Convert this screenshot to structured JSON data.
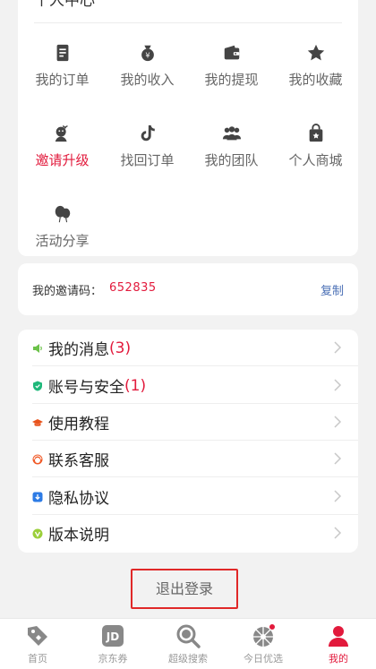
{
  "center": {
    "title": "个人中心",
    "grid": [
      {
        "label": "我的订单",
        "icon": "order-icon"
      },
      {
        "label": "我的收入",
        "icon": "money-bag-icon"
      },
      {
        "label": "我的提现",
        "icon": "wallet-icon"
      },
      {
        "label": "我的收藏",
        "icon": "star-icon"
      },
      {
        "label": "邀请升级",
        "icon": "invite-user-icon",
        "highlight": true
      },
      {
        "label": "找回订单",
        "icon": "tiktok-icon"
      },
      {
        "label": "我的团队",
        "icon": "team-icon"
      },
      {
        "label": "个人商城",
        "icon": "shopping-bag-icon"
      },
      {
        "label": "活动分享",
        "icon": "balloon-icon"
      }
    ]
  },
  "invite": {
    "label": "我的邀请码：",
    "code": "652835",
    "copy_label": "复制"
  },
  "menu": {
    "items": [
      {
        "label": "我的消息",
        "count": "(3)",
        "icon": "speaker-icon"
      },
      {
        "label": "账号与安全",
        "count": "(1)",
        "icon": "shield-icon"
      },
      {
        "label": "使用教程",
        "count": "",
        "icon": "graduation-cap-icon"
      },
      {
        "label": "联系客服",
        "count": "",
        "icon": "headset-icon"
      },
      {
        "label": "隐私协议",
        "count": "",
        "icon": "privacy-icon"
      },
      {
        "label": "版本说明",
        "count": "",
        "icon": "version-icon"
      }
    ]
  },
  "logout_label": "退出登录",
  "tabs": [
    {
      "label": "首页",
      "icon": "home-tag-icon",
      "active": false
    },
    {
      "label": "京东券",
      "icon": "jd-icon",
      "active": false
    },
    {
      "label": "超级搜索",
      "icon": "search-icon",
      "active": false
    },
    {
      "label": "今日优选",
      "icon": "shutter-icon",
      "active": false
    },
    {
      "label": "我的",
      "icon": "user-icon",
      "active": true
    }
  ],
  "colors": {
    "accent": "#e21a3c",
    "link": "#4a6fb5",
    "highlight_box": "#e02828"
  }
}
